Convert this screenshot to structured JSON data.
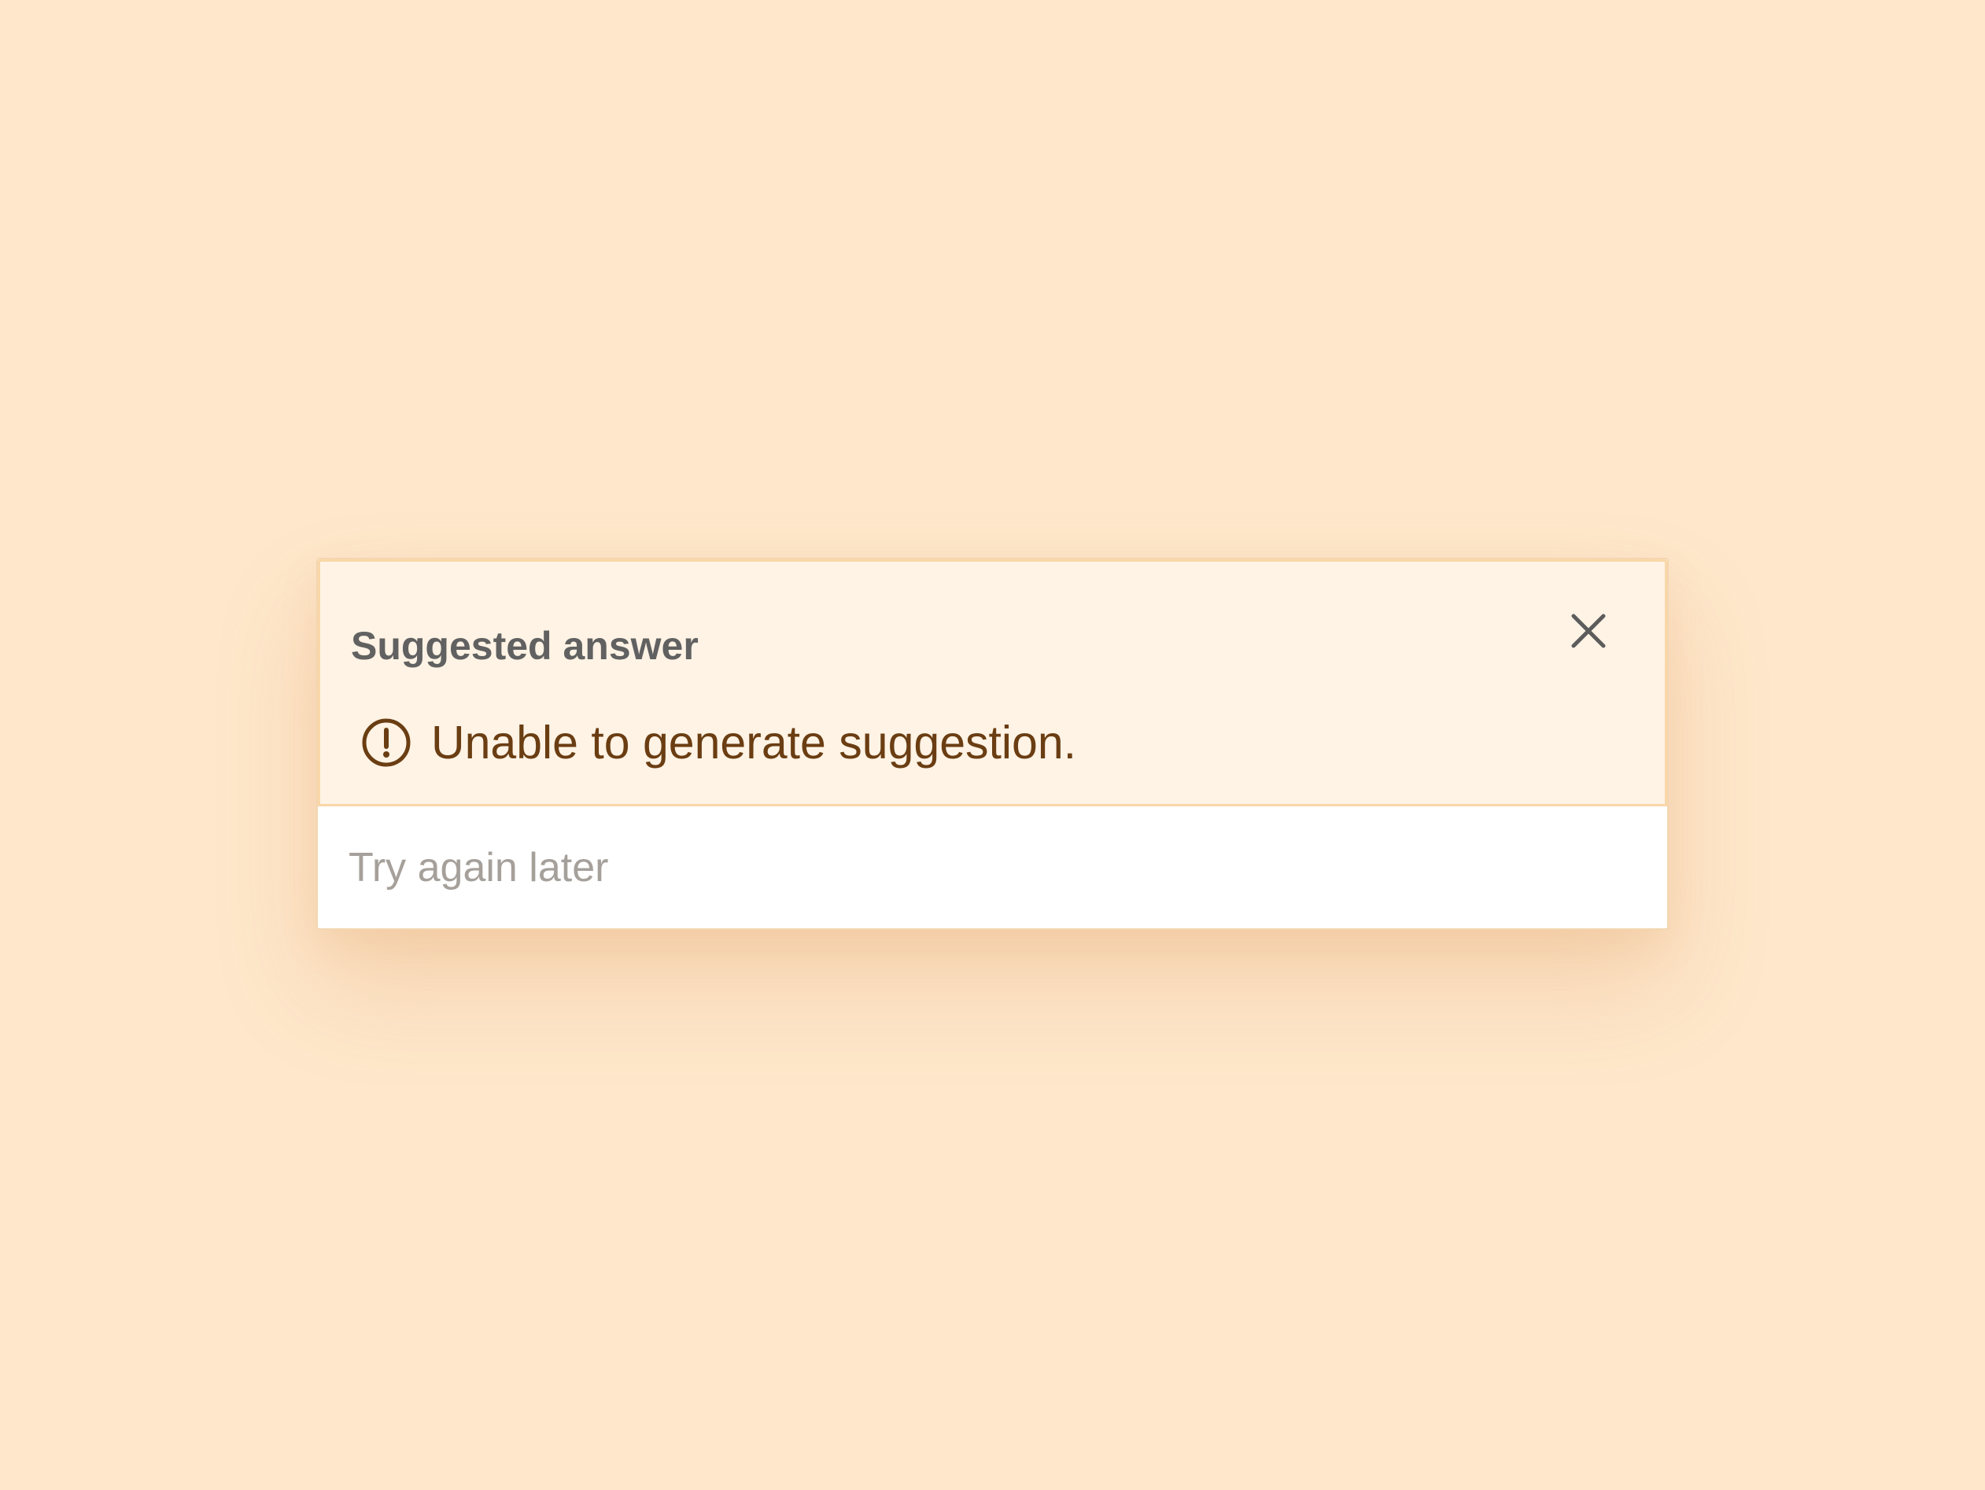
{
  "background_color": "#FEE7CB",
  "panel": {
    "title": "Suggested answer",
    "close_icon": "close-icon",
    "alert_icon": "alert-circle-icon",
    "error_message": "Unable to generate suggestion.",
    "footer_text": "Try again later",
    "colors": {
      "header_background": "#FEF3E5",
      "header_border": "#FAD7A8",
      "title_text": "#616161",
      "error_text": "#6A3D12",
      "footer_text": "#A6A09B"
    }
  }
}
